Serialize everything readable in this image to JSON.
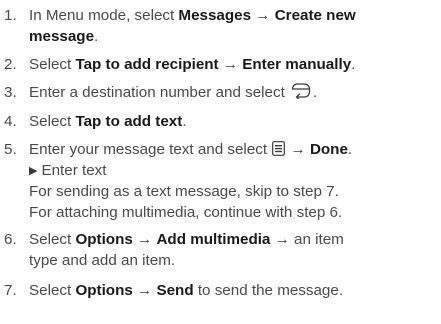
{
  "arrow": "→",
  "steps": [
    {
      "num": "1.",
      "pre": "In Menu mode, select ",
      "b1": "Messages",
      "b2": "Create new",
      "b3": "message",
      "post": "."
    },
    {
      "num": "2.",
      "pre": "Select ",
      "b1": "Tap to add recipient",
      "b2": "Enter manually",
      "post": "."
    },
    {
      "num": "3.",
      "pre": "Enter a destination number and select ",
      "post": ".",
      "icon": "return-icon"
    },
    {
      "num": "4.",
      "pre": "Select ",
      "b1": "Tap to add text",
      "post": "."
    },
    {
      "num": "5.",
      "pre": "Enter your message text and select ",
      "b1": "Done",
      "post": ".",
      "icon": "menu-icon",
      "ref_marker": "▶",
      "ref": "Enter text",
      "note1": "For sending as a text message, skip to step 7.",
      "note2": "For attaching multimedia, continue with step 6."
    },
    {
      "num": "6.",
      "pre": "Select ",
      "b1": "Options",
      "b2": "Add multimedia",
      "post1": " an item",
      "post2": "type and add an item."
    },
    {
      "num": "7.",
      "pre": "Select ",
      "b1": "Options",
      "b2": "Send",
      "post": " to send the message."
    }
  ]
}
